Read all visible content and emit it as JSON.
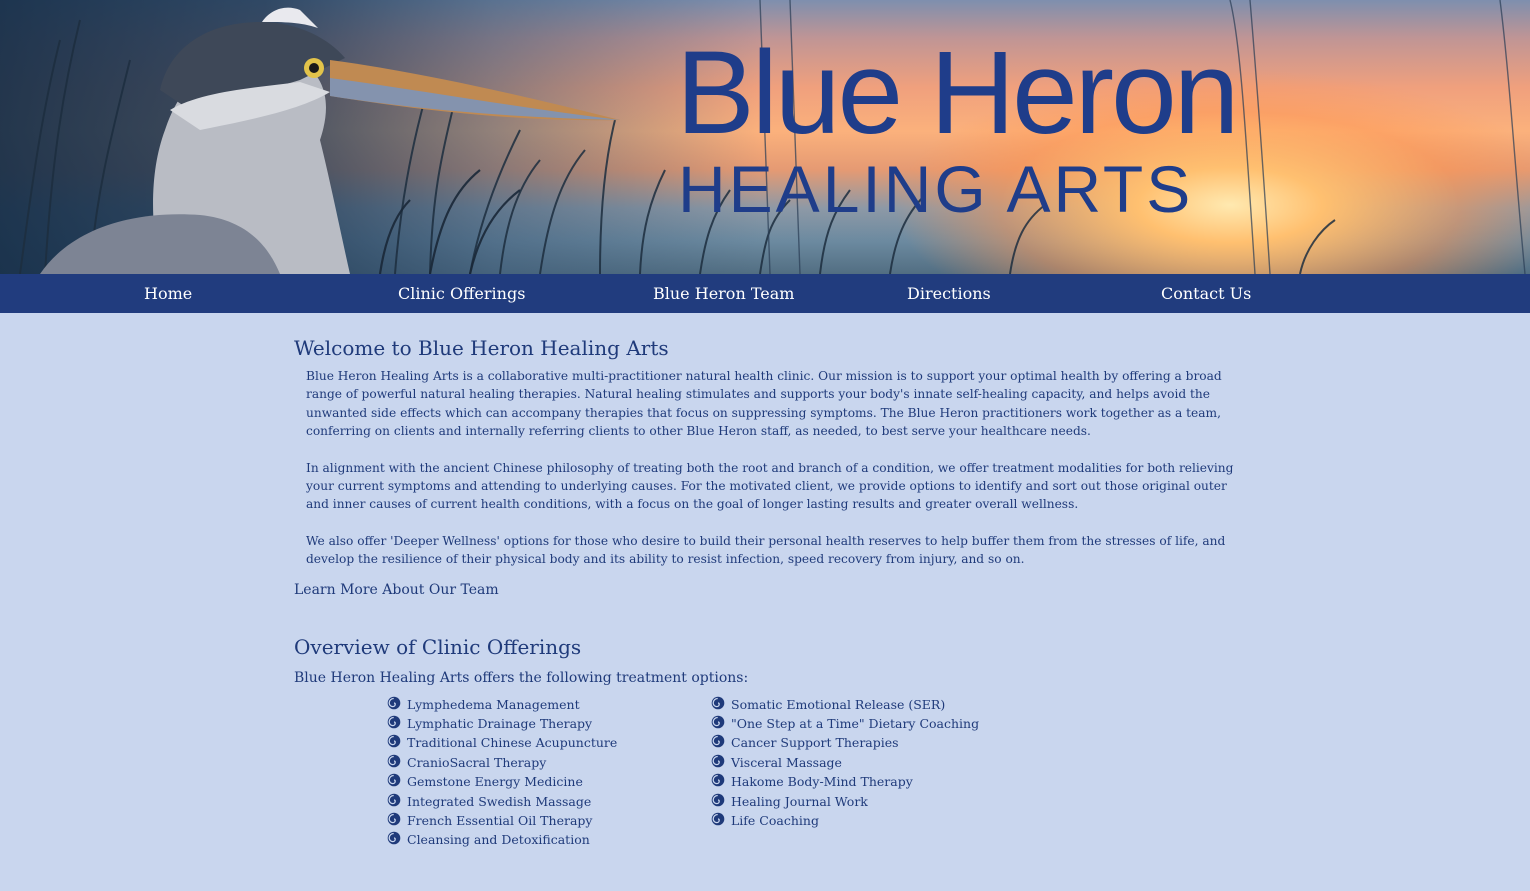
{
  "banner": {
    "logo_main": "Blue Heron",
    "logo_sub": "HEALING ARTS"
  },
  "nav": {
    "items": [
      {
        "label": "Home"
      },
      {
        "label": "Clinic Offerings"
      },
      {
        "label": "Blue Heron Team"
      },
      {
        "label": "Directions"
      },
      {
        "label": "Contact Us"
      }
    ]
  },
  "welcome": {
    "title": "Welcome to Blue Heron Healing Arts",
    "paragraphs": [
      "Blue Heron Healing Arts is a collaborative multi-practitioner natural health clinic. Our mission is to support your optimal health by offering a broad range of powerful natural healing therapies. Natural healing stimulates and supports your body's innate self-healing capacity, and helps avoid the unwanted side effects which can accompany therapies that focus on suppressing symptoms. The Blue Heron practitioners work together as a team, conferring on clients and internally referring clients to other Blue Heron staff, as needed, to best serve your healthcare needs.",
      "In alignment with the ancient Chinese philosophy of treating both the root and branch of a condition, we offer treatment modalities for both relieving your current symptoms and attending to underlying causes. For the motivated client, we provide options to identify and sort out those original outer and inner causes of current health conditions, with a focus on the goal of longer lasting results and greater overall wellness.",
      "We also offer 'Deeper Wellness' options for those who desire to build their personal health reserves to help buffer them from the stresses of life, and develop the resilience of their physical body and its ability to resist infection, speed recovery from injury, and so on."
    ],
    "team_link": "Learn More About Our Team"
  },
  "offerings": {
    "title": "Overview of Clinic Offerings",
    "intro": "Blue Heron Healing Arts offers the following treatment options:",
    "left": [
      "Lymphedema Management",
      "Lymphatic Drainage Therapy",
      "Traditional Chinese Acupuncture",
      "CranioSacral Therapy",
      "Gemstone Energy Medicine",
      "Integrated Swedish Massage",
      "French Essential Oil Therapy",
      "Cleansing and Detoxification"
    ],
    "right": [
      "Somatic Emotional Release (SER)",
      "\"One Step at a Time\" Dietary Coaching",
      "Cancer Support Therapies",
      "Visceral Massage",
      "Hakome Body-Mind Therapy",
      "Healing Journal Work",
      "Life Coaching"
    ],
    "bullet_icon": "spiral-icon"
  },
  "colors": {
    "background": "#c9d6ee",
    "nav": "#213c7e",
    "text": "#1f3a7a",
    "logo": "#1f3d8a"
  }
}
